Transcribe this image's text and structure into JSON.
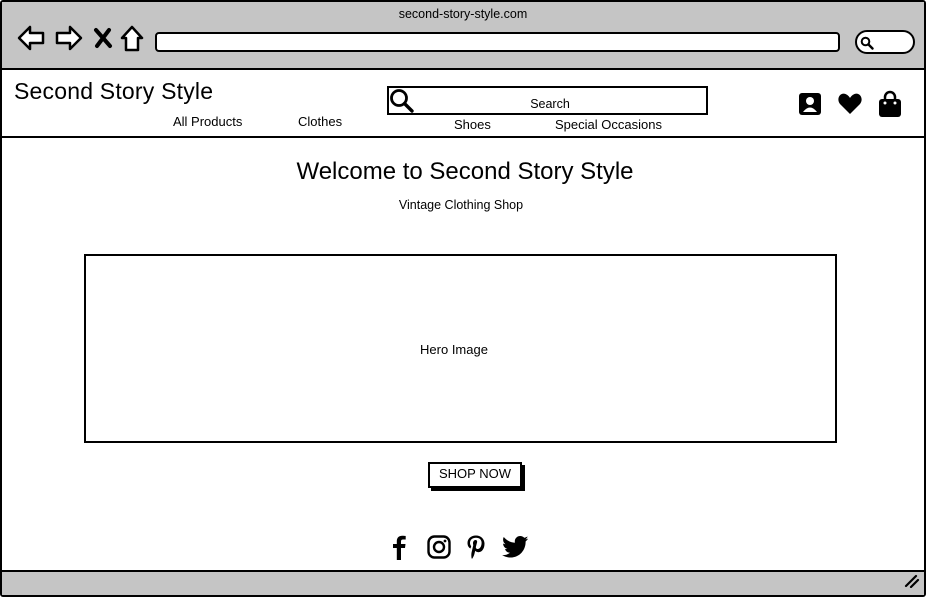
{
  "browser": {
    "url_title": "second-story-style.com",
    "address": "",
    "icons": [
      "back-arrow-icon",
      "forward-arrow-icon",
      "stop-icon",
      "home-icon",
      "search-icon",
      "resize-grip-icon"
    ]
  },
  "header": {
    "brand": "Second Story Style",
    "nav": [
      {
        "label": "All Products"
      },
      {
        "label": "Clothes"
      },
      {
        "label": "Shoes"
      },
      {
        "label": "Special Occasions"
      }
    ],
    "search": {
      "placeholder": "Search"
    },
    "icons": [
      "account-icon",
      "heart-icon",
      "shopping-bag-icon"
    ]
  },
  "main": {
    "title": "Welcome to Second Story Style",
    "subtitle": "Vintage Clothing Shop",
    "hero_label": "Hero Image",
    "cta_label": "SHOP NOW"
  },
  "footer": {
    "social_icons": [
      "facebook-icon",
      "instagram-icon",
      "pinterest-icon",
      "twitter-icon"
    ]
  },
  "colors": {
    "chrome": "#c5c5c5",
    "stroke": "#000000",
    "background": "#ffffff"
  }
}
